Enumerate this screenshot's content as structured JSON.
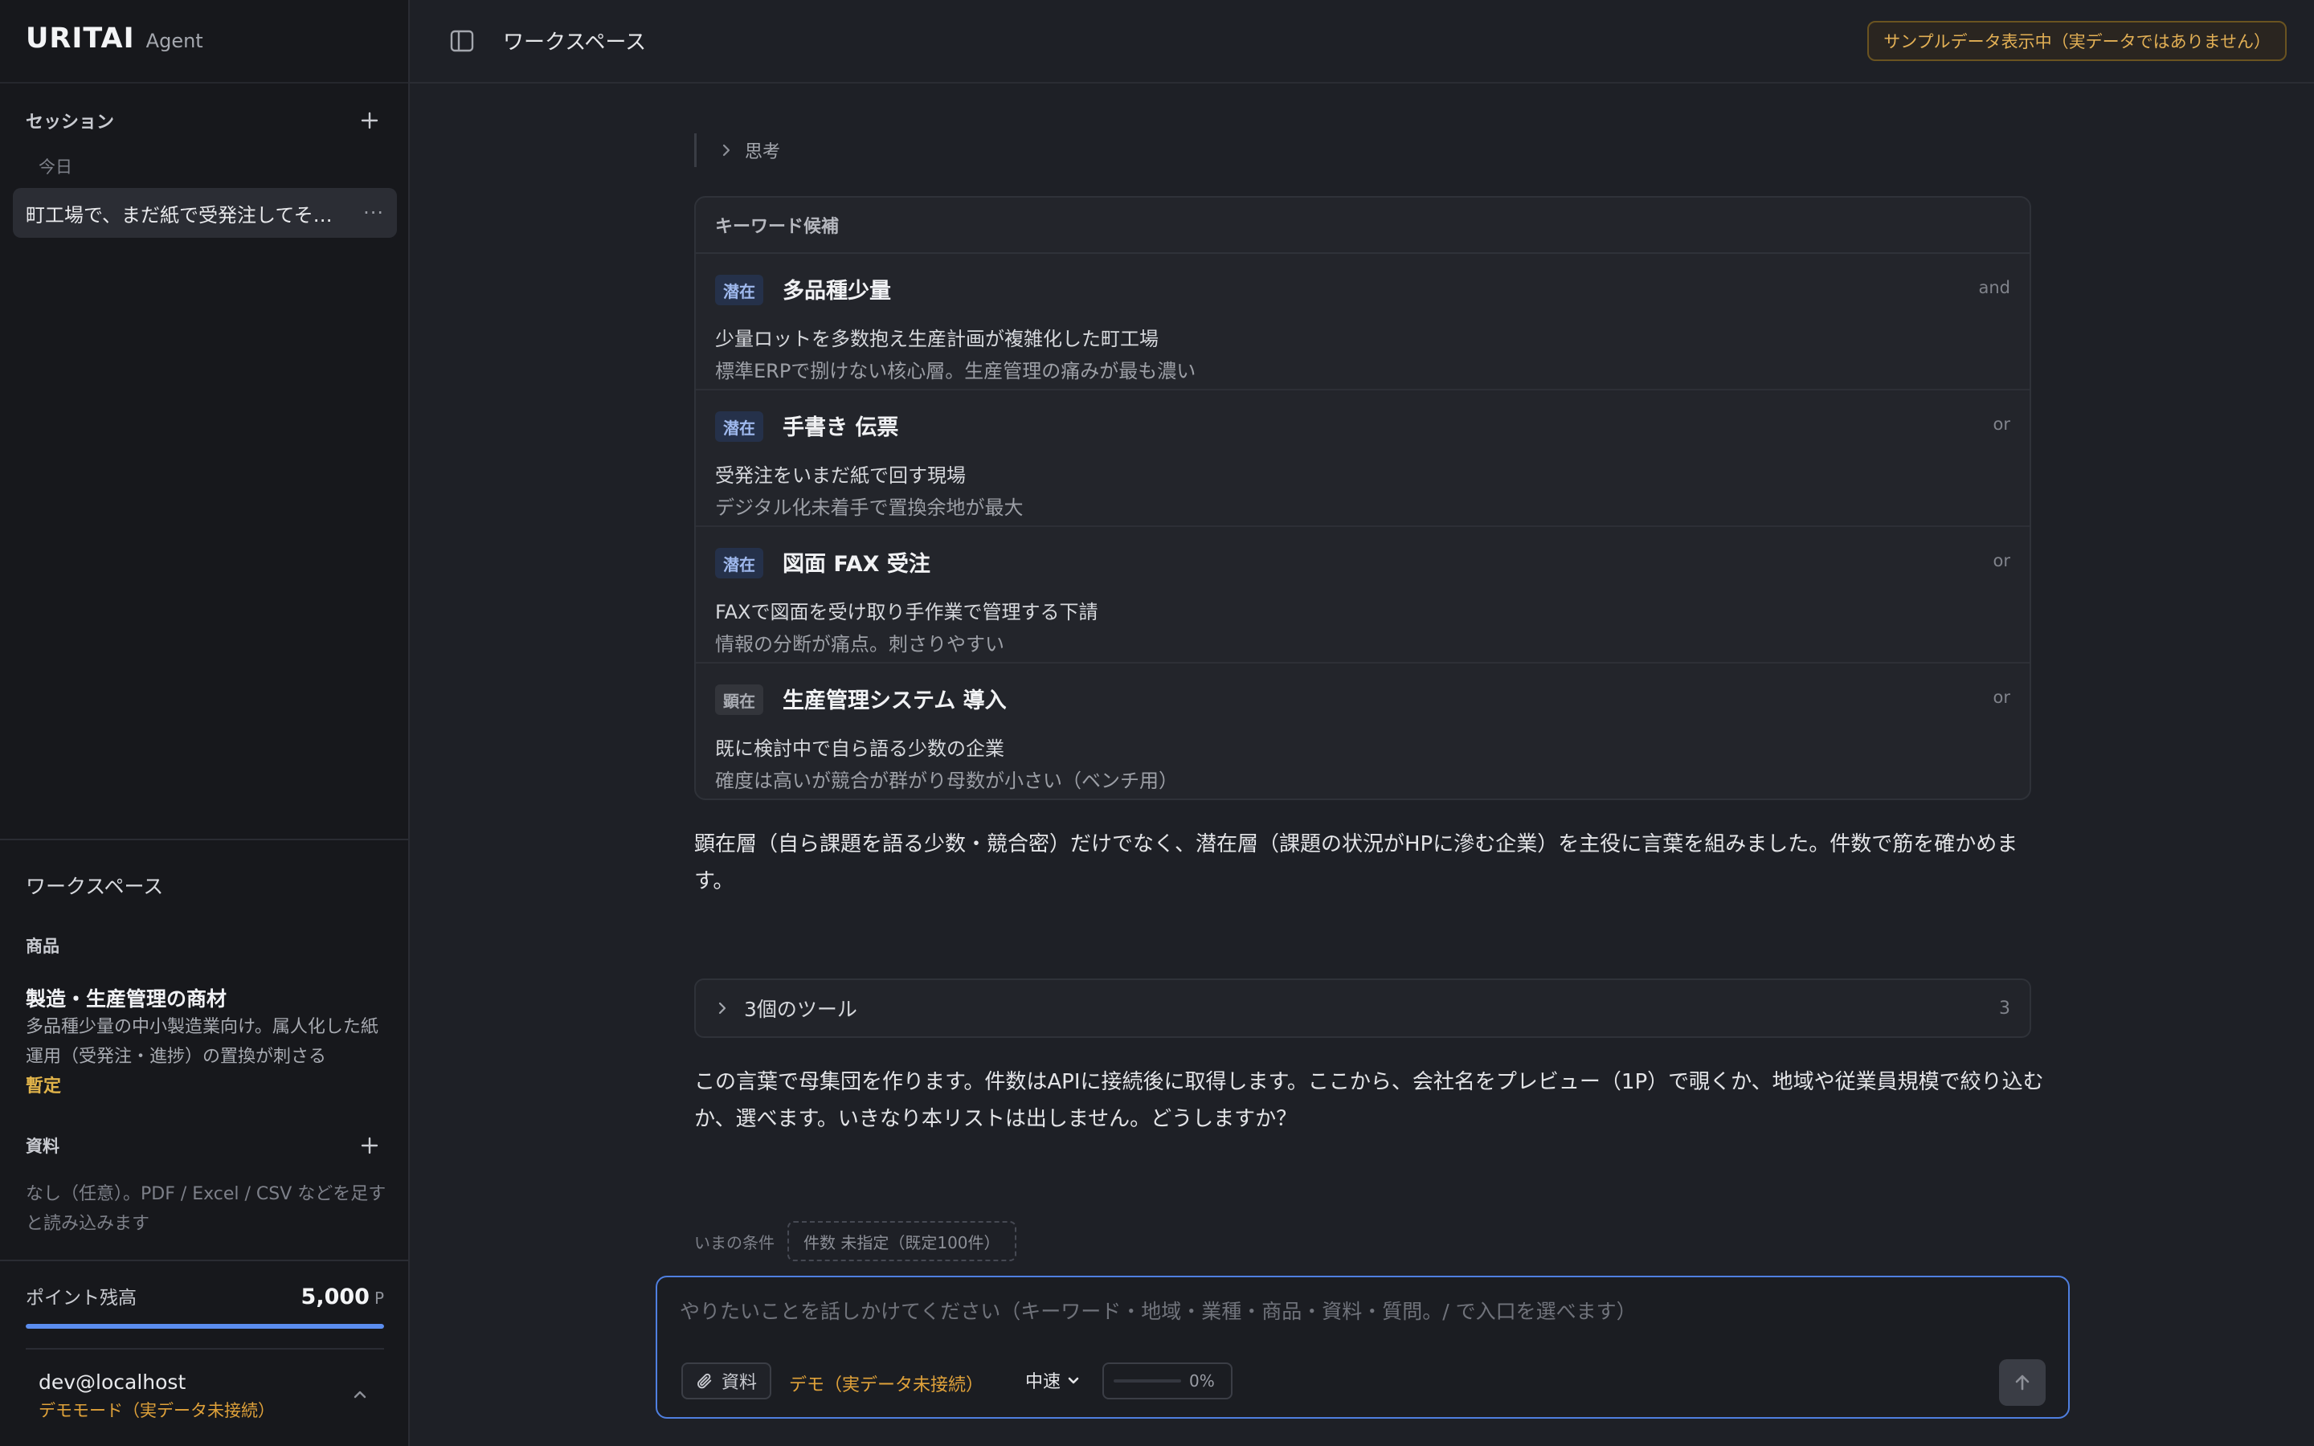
{
  "sidebar": {
    "brand": {
      "name": "URITAI",
      "sub": "Agent"
    },
    "sessions": {
      "label": "セッション",
      "group": "今日",
      "items": [
        {
          "title": "町工場で、まだ紙で受発注してそ…",
          "menu": "···"
        }
      ]
    },
    "workspace": {
      "title": "ワークスペース",
      "product": {
        "label": "商品",
        "name": "製造・生産管理の商材",
        "description": "多品種少量の中小製造業向け。属人化した紙運用（受発注・進捗）の置換が刺さる",
        "status": "暫定"
      },
      "materials": {
        "label": "資料",
        "description": "なし（任意）。PDF / Excel / CSV などを足すと読み込みます"
      }
    },
    "points": {
      "label": "ポイント残高",
      "value": "5,000",
      "unit": "P",
      "fill": 1.0
    },
    "user": {
      "name": "dev@localhost",
      "mode": "デモモード（実データ未接続）"
    }
  },
  "topbar": {
    "title": "ワークスペース",
    "badge": "サンプルデータ表示中（実データではありません）"
  },
  "thread": {
    "thinking_label": "思考",
    "keywords": {
      "header": "キーワード候補",
      "items": [
        {
          "tag": "潜在",
          "tag_kind": "latent",
          "name": "多品種少量",
          "op": "and",
          "line1": "少量ロットを多数抱え生産計画が複雑化した町工場",
          "line2": "標準ERPで捌けない核心層。生産管理の痛みが最も濃い"
        },
        {
          "tag": "潜在",
          "tag_kind": "latent",
          "name": "手書き 伝票",
          "op": "or",
          "line1": "受発注をいまだ紙で回す現場",
          "line2": "デジタル化未着手で置換余地が最大"
        },
        {
          "tag": "潜在",
          "tag_kind": "latent",
          "name": "図面 FAX 受注",
          "op": "or",
          "line1": "FAXで図面を受け取り手作業で管理する下請",
          "line2": "情報の分断が痛点。刺さりやすい"
        },
        {
          "tag": "顕在",
          "tag_kind": "overt",
          "name": "生産管理システム 導入",
          "op": "or",
          "line1": "既に検討中で自ら語る少数の企業",
          "line2": "確度は高いが競合が群がり母数が小さい（ベンチ用）"
        }
      ]
    },
    "message1": "顕在層（自ら課題を語る少数・競合密）だけでなく、潜在層（課題の状況がHPに滲む企業）を主役に言葉を組みました。件数で筋を確かめます。",
    "tools": {
      "label": "3個のツール",
      "count": "3"
    },
    "message2": "この言葉で母集団を作ります。件数はAPIに接続後に取得します。ここから、会社名をプレビュー（1P）で覗くか、地域や従業員規模で絞り込むか、選べます。いきなり本リストは出しません。どうしますか？",
    "conditions": {
      "label": "いまの条件",
      "chip": "件数 未指定（既定100件）"
    }
  },
  "composer": {
    "placeholder": "やりたいことを話しかけてください（キーワード・地域・業種・商品・資料・質問。/ で入口を選べます）",
    "value": "",
    "attach_label": "資料",
    "demo_label": "デモ（実データ未接続）",
    "speed": "中速",
    "progress": {
      "value": 0,
      "label": "0%"
    }
  },
  "colors": {
    "accent": "#5b8def",
    "warning": "#e0a23a",
    "background": "#1e2026",
    "sidebar": "#17181c"
  },
  "icons": {
    "add": "plus-icon",
    "menu": "ellipsis-icon",
    "toggle": "sidebar-toggle-icon",
    "expand": "chevron-right-icon",
    "attach": "paperclip-icon",
    "dropdown": "chevron-down-icon",
    "send": "arrow-up-icon",
    "account": "chevron-up-icon"
  }
}
